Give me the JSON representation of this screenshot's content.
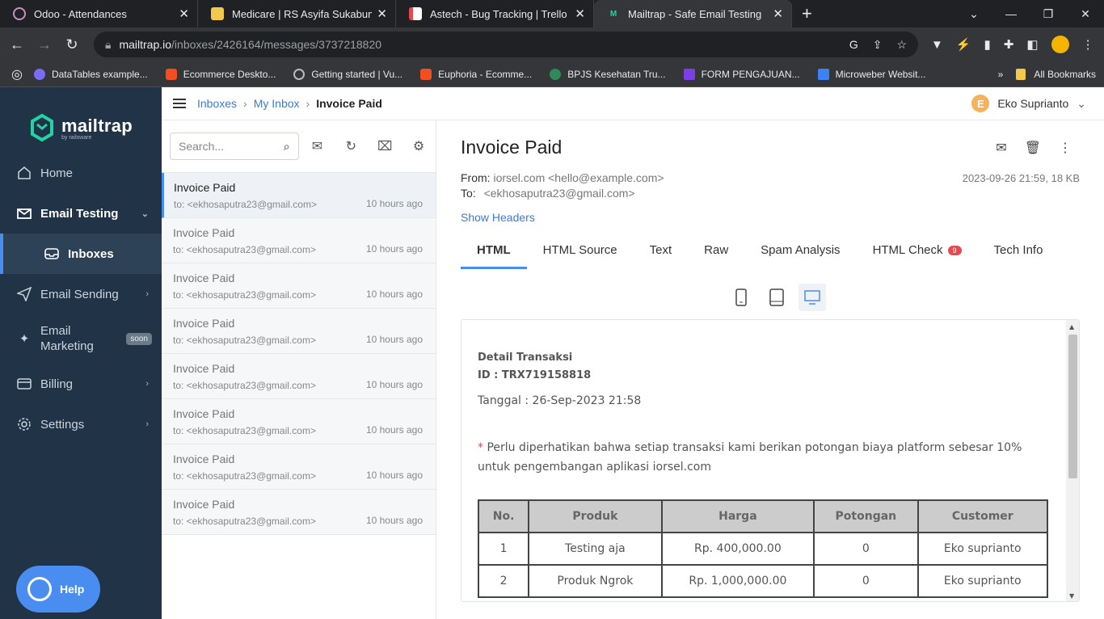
{
  "browser": {
    "tabs": [
      {
        "title": "Odoo - Attendances",
        "color": "#7c4d79"
      },
      {
        "title": "Medicare | RS Asyifa Sukabumi",
        "color": "#f2c94c"
      },
      {
        "title": "Astech - Bug Tracking | Trello",
        "color": "#e5484d"
      },
      {
        "title": "Mailtrap - Safe Email Testing",
        "color": "#22d3a6"
      }
    ],
    "url_domain": "mailtrap.io",
    "url_path": "/inboxes/2426164/messages/3737218820",
    "bookmarks": [
      "DataTables example...",
      "Ecommerce Deskto...",
      "Getting started | Vu...",
      "Euphoria - Ecomme...",
      "BPJS Kesehatan Tru...",
      "FORM PENGAJUAN...",
      "Microweber Websit..."
    ],
    "all_bookmarks": "All Bookmarks"
  },
  "sidebar": {
    "brand": "mailtrap",
    "brand_sub": "by railsware",
    "items": [
      {
        "label": "Home"
      },
      {
        "label": "Email Testing"
      },
      {
        "label": "Inboxes"
      },
      {
        "label": "Email Sending"
      },
      {
        "label": "Email Marketing"
      },
      {
        "label": "Billing"
      },
      {
        "label": "Settings"
      }
    ],
    "soon": "soon",
    "help": "Help"
  },
  "header": {
    "crumbs": [
      "Inboxes",
      "My Inbox",
      "Invoice Paid"
    ],
    "user_initial": "E",
    "user_name": "Eko Suprianto"
  },
  "list": {
    "search_placeholder": "Search...",
    "messages": [
      {
        "subject": "Invoice Paid",
        "to": "to: <ekhosaputra23@gmail.com>",
        "time": "10 hours ago"
      },
      {
        "subject": "Invoice Paid",
        "to": "to: <ekhosaputra23@gmail.com>",
        "time": "10 hours ago"
      },
      {
        "subject": "Invoice Paid",
        "to": "to: <ekhosaputra23@gmail.com>",
        "time": "10 hours ago"
      },
      {
        "subject": "Invoice Paid",
        "to": "to: <ekhosaputra23@gmail.com>",
        "time": "10 hours ago"
      },
      {
        "subject": "Invoice Paid",
        "to": "to: <ekhosaputra23@gmail.com>",
        "time": "10 hours ago"
      },
      {
        "subject": "Invoice Paid",
        "to": "to: <ekhosaputra23@gmail.com>",
        "time": "10 hours ago"
      },
      {
        "subject": "Invoice Paid",
        "to": "to: <ekhosaputra23@gmail.com>",
        "time": "10 hours ago"
      },
      {
        "subject": "Invoice Paid",
        "to": "to: <ekhosaputra23@gmail.com>",
        "time": "10 hours ago"
      }
    ]
  },
  "message": {
    "title": "Invoice Paid",
    "from_label": "From:",
    "from": "iorsel.com <hello@example.com>",
    "to_label": "To:",
    "to": "<ekhosaputra23@gmail.com>",
    "meta": "2023-09-26 21:59, 18 KB",
    "show_headers": "Show Headers",
    "tabs": [
      "HTML",
      "HTML Source",
      "Text",
      "Raw",
      "Spam Analysis",
      "HTML Check",
      "Tech Info"
    ],
    "html_check_count": "9"
  },
  "email": {
    "heading": "Detail Transaksi",
    "id": "ID : TRX719158818",
    "date": "Tanggal : 26-Sep-2023 21:58",
    "star": "*",
    "note": " Perlu diperhatikan bahwa setiap transaksi kami berikan potongan biaya platform sebesar 10% untuk pengembangan aplikasi iorsel.com",
    "columns": [
      "No.",
      "Produk",
      "Harga",
      "Potongan",
      "Customer"
    ],
    "rows": [
      [
        "1",
        "Testing aja",
        "Rp. 400,000.00",
        "0",
        "Eko suprianto"
      ],
      [
        "2",
        "Produk Ngrok",
        "Rp. 1,000,000.00",
        "0",
        "Eko suprianto"
      ]
    ]
  }
}
